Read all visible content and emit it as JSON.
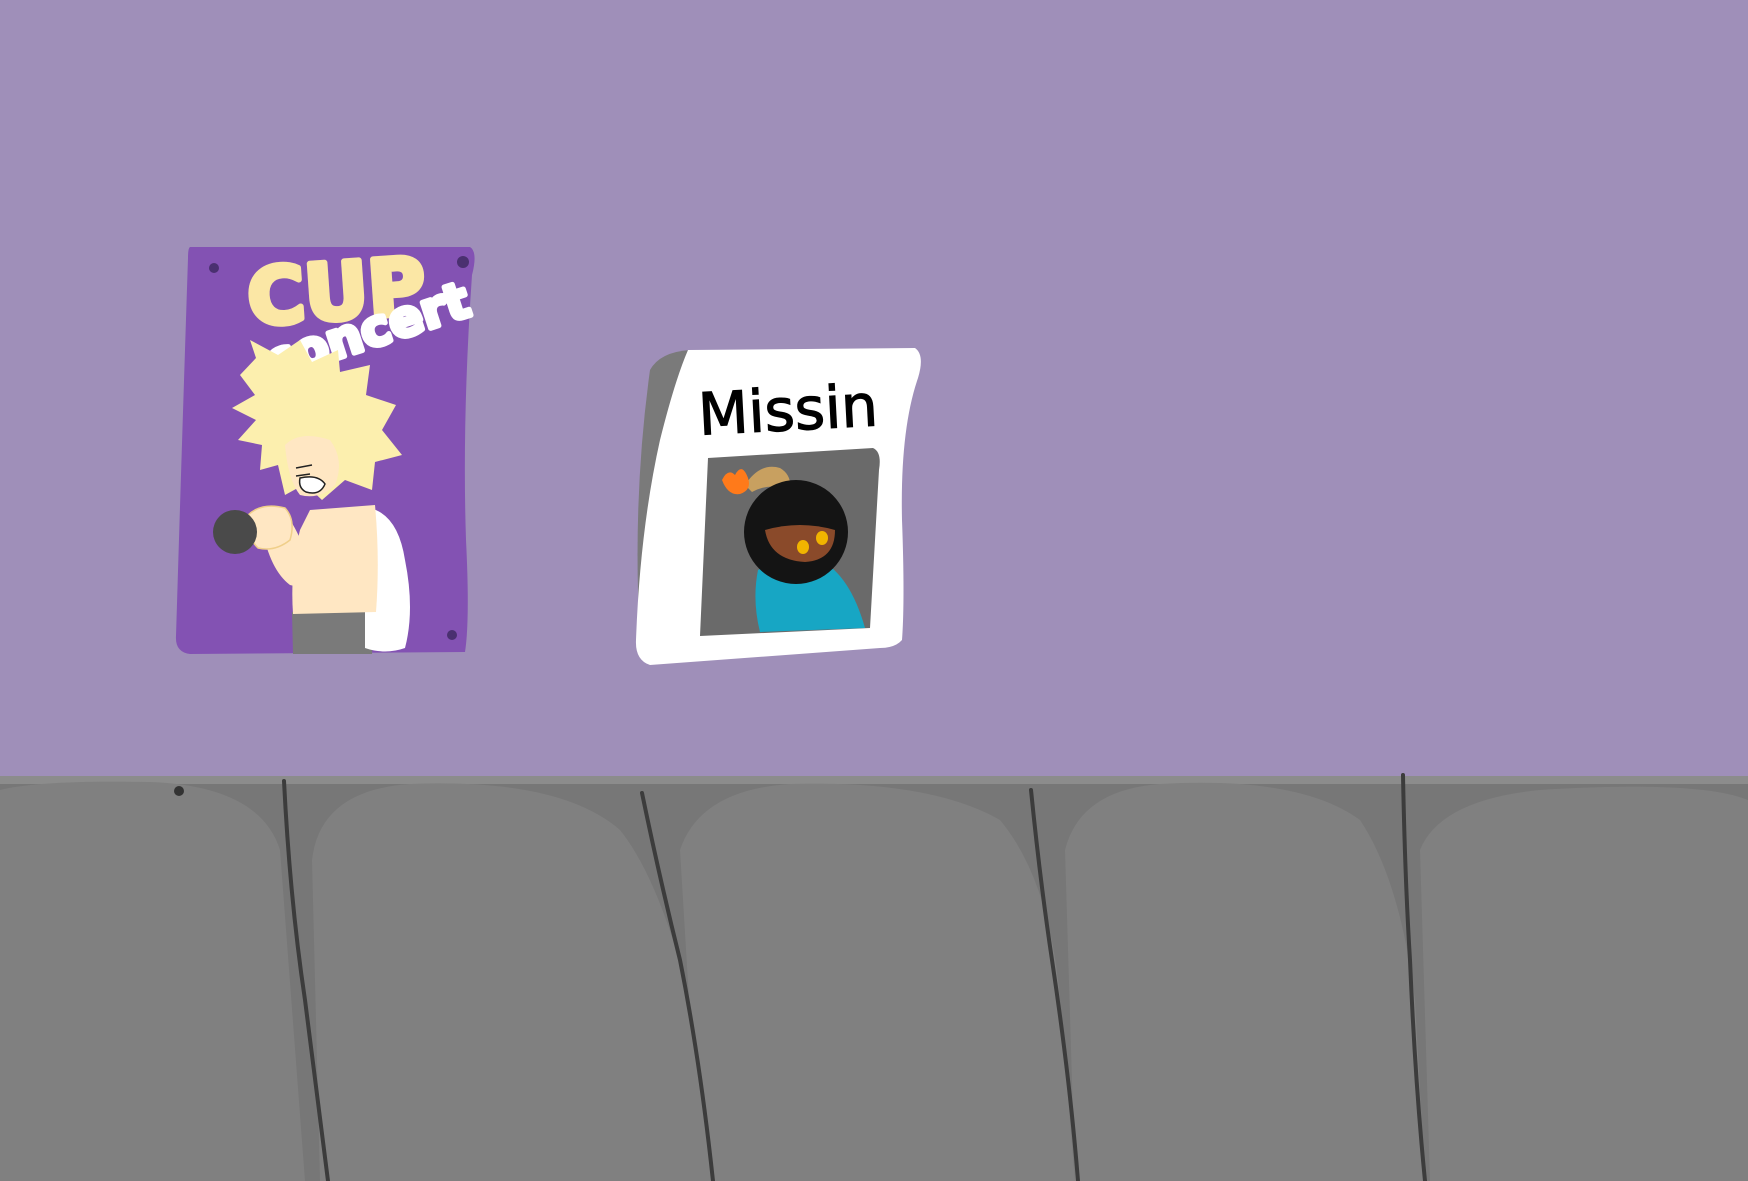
{
  "scene": {
    "wall_color": "#9f8fb9",
    "bench_color": "#777777",
    "seat_color": "#808080",
    "seam_color": "#3c3c3c",
    "ledge_color": "#8c8c8c"
  },
  "concert_poster": {
    "title_line_1": "CUP",
    "title_line_2": "concert",
    "background_color": "#8352b3",
    "title_color": "#fbe7a5",
    "subtitle_color": "#ffffff",
    "hair_color": "#fcefae",
    "skin_color": "#ffe7c3",
    "sleeve_color": "#ffffff",
    "pants_color": "#7a7a7a",
    "microphone_color": "#4a4a4a"
  },
  "missing_poster": {
    "title": "Missin",
    "paper_color": "#ffffff",
    "photo_bg_color": "#6a6a6a",
    "bomb_color": "#141414",
    "fuse_color": "#c8a060",
    "flame_color": "#ff7a1a",
    "eye_color": "#f1b400",
    "face_color": "#8a4a2a",
    "shirt_color": "#17a6c4"
  }
}
